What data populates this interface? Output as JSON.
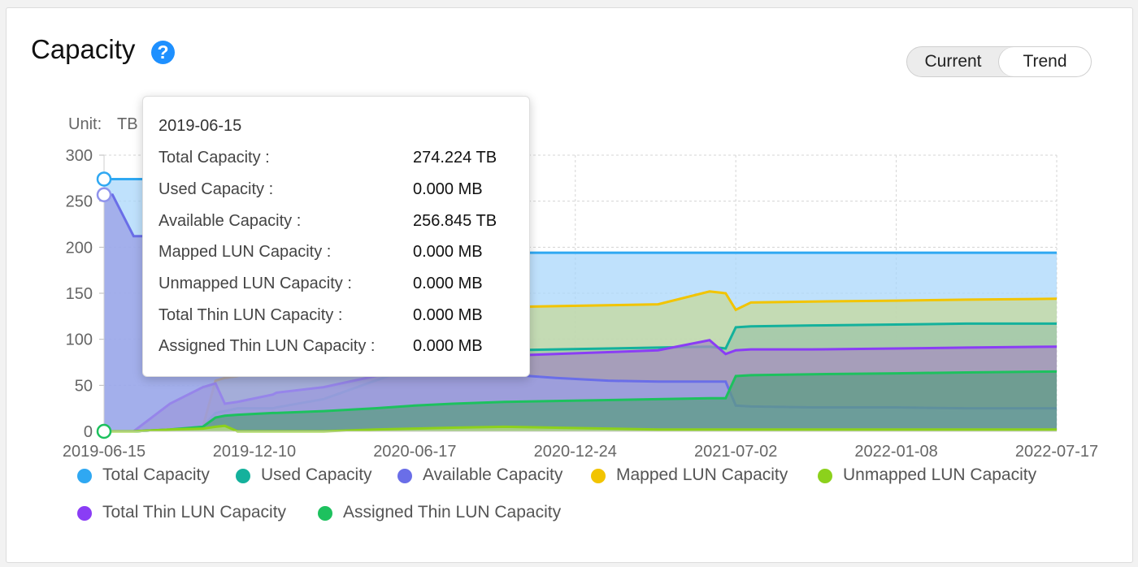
{
  "header": {
    "title": "Capacity",
    "help_icon": "?"
  },
  "toggle": {
    "options": [
      "Current",
      "Trend"
    ],
    "selected": "Trend"
  },
  "chart_data": {
    "type": "area",
    "unit_label": "Unit:",
    "unit": "TB",
    "ylim": [
      0,
      300
    ],
    "yticks": [
      "0",
      "50",
      "100",
      "150",
      "200",
      "250",
      "300"
    ],
    "xticks": [
      "2019-06-15",
      "2019-12-10",
      "2020-06-17",
      "2020-12-24",
      "2021-07-02",
      "2022-01-08",
      "2022-07-17"
    ],
    "x": [
      "2019-06-15",
      "2019-06-25",
      "2019-07-20",
      "2019-09-01",
      "2019-10-10",
      "2019-10-25",
      "2019-11-05",
      "2019-11-20",
      "2020-01-01",
      "2020-01-05",
      "2020-03-01",
      "2020-05-01",
      "2020-06-17",
      "2020-08-01",
      "2020-10-01",
      "2020-12-01",
      "2021-02-01",
      "2021-04-01",
      "2021-06-01",
      "2021-06-20",
      "2021-07-02",
      "2021-07-20",
      "2021-10-01",
      "2022-01-08",
      "2022-04-01",
      "2022-07-17"
    ],
    "series": [
      {
        "name": "Total Capacity",
        "color": "#2fa8f2",
        "fill": "#a9d7fb",
        "values": [
          274,
          274,
          274,
          274,
          274,
          274,
          274,
          274,
          194,
          194,
          194,
          194,
          194,
          194,
          194,
          194,
          194,
          194,
          194,
          194,
          194,
          194,
          194,
          194,
          194,
          194
        ]
      },
      {
        "name": "Mapped LUN Capacity",
        "color": "#f2c400",
        "fill": "#c6d89c",
        "values": [
          0,
          0,
          0,
          2,
          5,
          55,
          58,
          60,
          75,
          80,
          92,
          105,
          118,
          120,
          135,
          136,
          137,
          138,
          152,
          150,
          132,
          140,
          141,
          142,
          143,
          144
        ]
      },
      {
        "name": "Used Capacity",
        "color": "#14b19c",
        "fill": "#9fc6a8",
        "values": [
          0,
          0,
          0,
          2,
          5,
          20,
          22,
          25,
          25,
          26,
          35,
          55,
          70,
          80,
          88,
          89,
          90,
          91,
          92,
          90,
          113,
          114,
          115,
          116,
          117,
          117
        ]
      },
      {
        "name": "Total Thin LUN Capacity",
        "color": "#8a3df5",
        "fill": "#a58fbf",
        "values": [
          0,
          0,
          0,
          30,
          48,
          52,
          30,
          32,
          40,
          42,
          48,
          60,
          70,
          75,
          82,
          84,
          86,
          88,
          99,
          84,
          88,
          89,
          89,
          90,
          91,
          92
        ]
      },
      {
        "name": "Available Capacity",
        "color": "#6a6ee8",
        "fill": "#9a9ee6",
        "values": [
          257,
          257,
          212,
          212,
          212,
          212,
          212,
          212,
          120,
          118,
          110,
          90,
          75,
          70,
          62,
          58,
          55,
          54,
          54,
          54,
          28,
          27,
          26,
          26,
          25,
          25
        ]
      },
      {
        "name": "Assigned Thin LUN Capacity",
        "color": "#1dc15e",
        "fill": "#5c9c84",
        "values": [
          0,
          0,
          0,
          2,
          5,
          15,
          17,
          18,
          20,
          20,
          22,
          25,
          28,
          30,
          32,
          33,
          34,
          35,
          36,
          36,
          60,
          61,
          62,
          63,
          64,
          65
        ]
      },
      {
        "name": "Unmapped LUN Capacity",
        "color": "#8cd11c",
        "fill": "#b8e07a",
        "values": [
          0,
          0,
          0,
          2,
          3,
          5,
          6,
          0,
          0,
          0,
          0,
          2,
          3,
          4,
          5,
          4,
          3,
          2,
          2,
          2,
          2,
          2,
          2,
          2,
          2,
          2
        ]
      }
    ],
    "legend": [
      {
        "name": "Total Capacity",
        "color": "#2fa8f2"
      },
      {
        "name": "Used Capacity",
        "color": "#14b19c"
      },
      {
        "name": "Available Capacity",
        "color": "#6a6ee8"
      },
      {
        "name": "Mapped LUN Capacity",
        "color": "#f2c400"
      },
      {
        "name": "Unmapped LUN Capacity",
        "color": "#8cd11c"
      },
      {
        "name": "Total Thin LUN Capacity",
        "color": "#8a3df5"
      },
      {
        "name": "Assigned Thin LUN Capacity",
        "color": "#1dc15e"
      }
    ],
    "hover_x": "2019-06-15",
    "grid": true,
    "legend_position": "bottom"
  },
  "tooltip": {
    "date": "2019-06-15",
    "rows": [
      {
        "label": "Total Capacity :",
        "value": "274.224 TB"
      },
      {
        "label": "Used Capacity :",
        "value": "0.000 MB"
      },
      {
        "label": "Available Capacity :",
        "value": "256.845 TB"
      },
      {
        "label": "Mapped LUN Capacity :",
        "value": "0.000 MB"
      },
      {
        "label": "Unmapped LUN Capacity :",
        "value": "0.000 MB"
      },
      {
        "label": "Total Thin LUN Capacity :",
        "value": "0.000 MB"
      },
      {
        "label": "Assigned Thin LUN Capacity :",
        "value": "0.000 MB"
      }
    ]
  }
}
